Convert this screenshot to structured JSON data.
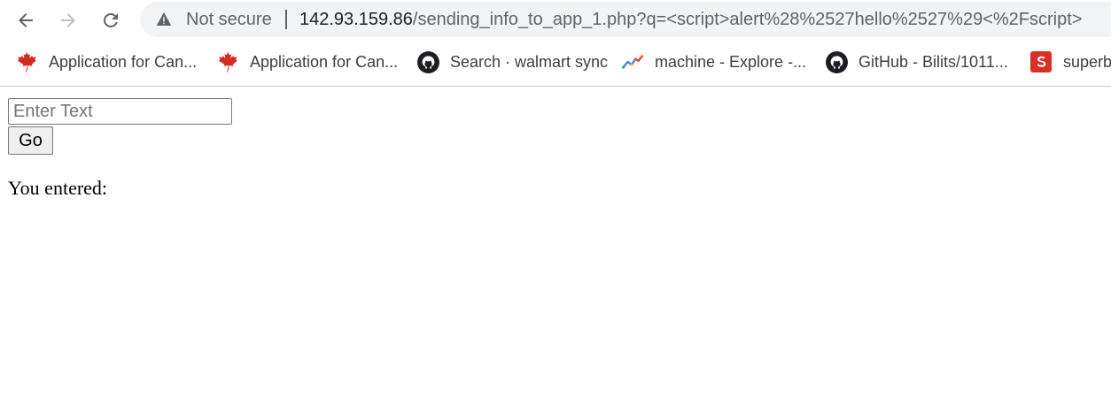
{
  "browser": {
    "security_label": "Not secure",
    "url_host": "142.93.159.86",
    "url_path": "/sending_info_to_app_1.php?q=<script>alert%28%2527hello%2527%29<%2Fscript>"
  },
  "bookmarks": [
    {
      "label": "Application for Can...",
      "icon": "maple-leaf-icon"
    },
    {
      "label": "Application for Can...",
      "icon": "maple-leaf-icon"
    },
    {
      "label": "Search · walmart sync",
      "icon": "github-icon"
    },
    {
      "label": "machine - Explore -...",
      "icon": "trend-chart-icon"
    },
    {
      "label": "GitHub - Bilits/1011...",
      "icon": "github-icon"
    },
    {
      "label": "superb",
      "icon": "superb-s-icon"
    }
  ],
  "form": {
    "input_placeholder": "Enter Text",
    "input_value": "",
    "go_label": "Go",
    "result_label": "You entered:"
  },
  "colors": {
    "maple": "#d52b1e",
    "superb_bg": "#d93025",
    "omnibox_bg": "#f1f3f4"
  }
}
